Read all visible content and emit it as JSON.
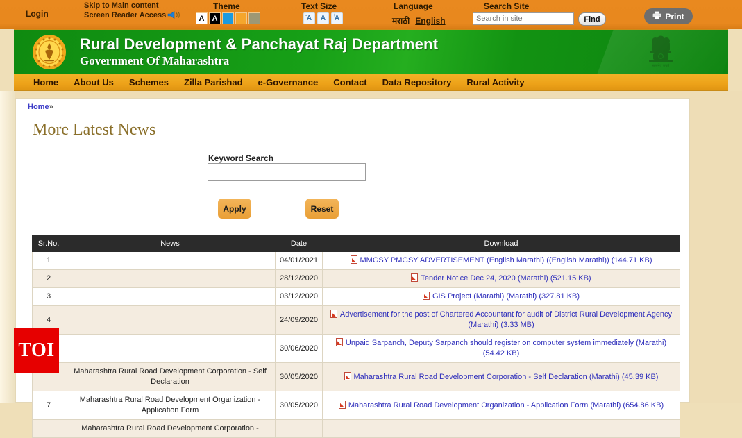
{
  "topbar": {
    "login": "Login",
    "skip_to_main": "Skip to Main content",
    "screen_reader": "Screen Reader Access",
    "theme_label": "Theme",
    "theme_swatches": [
      {
        "name": "theme-white",
        "label": "A",
        "color": "#ffffff"
      },
      {
        "name": "theme-black",
        "label": "A",
        "color": "#000000"
      },
      {
        "name": "theme-blue",
        "label": "",
        "color": "#1b9ae0"
      },
      {
        "name": "theme-orange",
        "label": "",
        "color": "#f5a62c"
      },
      {
        "name": "theme-olive",
        "label": "",
        "color": "#9d9875"
      }
    ],
    "text_size_label": "Text Size",
    "text_size_buttons": [
      {
        "name": "text-size-decrease",
        "label": "A",
        "mark": "-"
      },
      {
        "name": "text-size-normal",
        "label": "A",
        "mark": ""
      },
      {
        "name": "text-size-increase",
        "label": "A",
        "mark": "+"
      }
    ],
    "language_label": "Language",
    "language_marathi": "मराठी",
    "language_english": "English",
    "search_site_label": "Search Site",
    "search_placeholder": "Search in site",
    "search_value": "",
    "find_label": "Find",
    "print_label": "Print"
  },
  "header": {
    "title": "Rural Development & Panchayat Raj Department",
    "subtitle": "Government Of Maharashtra"
  },
  "nav": {
    "items": [
      {
        "label": "Home"
      },
      {
        "label": "About Us"
      },
      {
        "label": "Schemes"
      },
      {
        "label": "Zilla Parishad"
      },
      {
        "label": "e-Governance"
      },
      {
        "label": "Contact"
      },
      {
        "label": "Data Repository"
      },
      {
        "label": "Rural Activity"
      }
    ]
  },
  "main": {
    "breadcrumb_home": "Home",
    "breadcrumb_sep": "»",
    "page_title": "More Latest News",
    "keyword_label": "Keyword Search",
    "keyword_value": "",
    "keyword_placeholder": "",
    "apply_label": "Apply",
    "reset_label": "Reset"
  },
  "table": {
    "headers": [
      "Sr.No.",
      "News",
      "Date",
      "Download"
    ],
    "rows": [
      {
        "sr": "1",
        "news": "",
        "date": "04/01/2021",
        "download": "MMGSY PMGSY ADVERTISEMENT (English Marathi) ((English Marathi)) (144.71 KB)"
      },
      {
        "sr": "2",
        "news": "",
        "date": "28/12/2020",
        "download": "Tender Notice Dec 24, 2020 (Marathi) (521.15 KB)"
      },
      {
        "sr": "3",
        "news": "",
        "date": "03/12/2020",
        "download": "GIS Project (Marathi) (Marathi) (327.81 KB)"
      },
      {
        "sr": "4",
        "news": "",
        "date": "24/09/2020",
        "download": "Advertisement for the post of Chartered Accountant for audit of District Rural Development Agency (Marathi) (3.33 MB)"
      },
      {
        "sr": "",
        "news": "",
        "date": "30/06/2020",
        "download": "Unpaid Sarpanch, Deputy Sarpanch should register on computer system immediately (Marathi) (54.42 KB)"
      },
      {
        "sr": "",
        "news": "Maharashtra Rural Road Development Corporation - Self Declaration",
        "date": "30/05/2020",
        "download": "Maharashtra Rural Road Development Corporation - Self Declaration (Marathi) (45.39 KB)"
      },
      {
        "sr": "7",
        "news": "Maharashtra Rural Road Development Organization - Application Form",
        "date": "30/05/2020",
        "download": "Maharashtra Rural Road Development Organization - Application Form (Marathi) (654.86 KB)"
      },
      {
        "sr": "",
        "news": "Maharashtra Rural Road Development Corporation -",
        "date": "",
        "download": ""
      }
    ]
  },
  "watermark": {
    "label": "TOI"
  },
  "colors": {
    "topbar_orange": "#e8881e",
    "header_green": "#179417",
    "nav_orange": "#eda219",
    "page_cream": "#eeddb6",
    "link_blue": "#2d2dbb",
    "title_gold": "#8a6f2a",
    "table_header": "#2b2b2b",
    "row_alt": "#f4ece0",
    "watermark_red": "#e60000"
  }
}
